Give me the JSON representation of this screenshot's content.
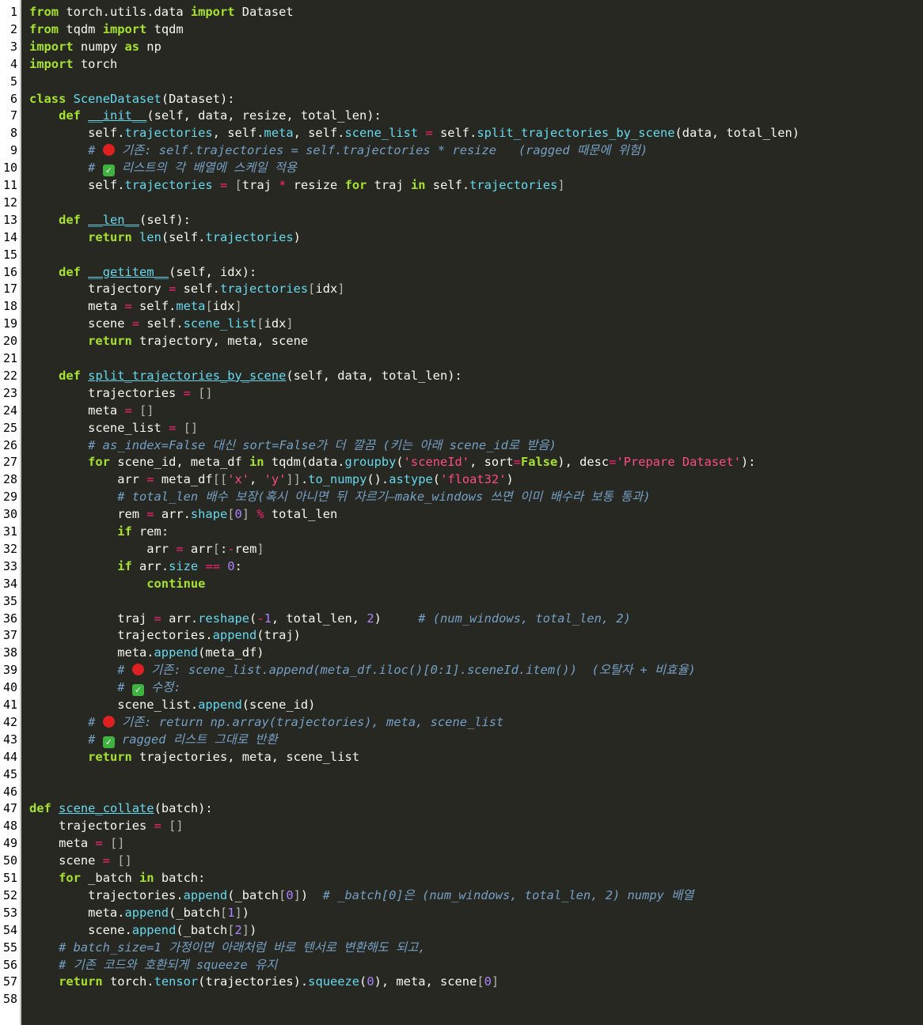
{
  "line_numbers": [
    "1",
    "2",
    "3",
    "4",
    "5",
    "6",
    "7",
    "8",
    "9",
    "10",
    "11",
    "12",
    "13",
    "14",
    "15",
    "16",
    "17",
    "18",
    "19",
    "20",
    "21",
    "22",
    "23",
    "24",
    "25",
    "26",
    "27",
    "28",
    "29",
    "30",
    "31",
    "32",
    "33",
    "34",
    "35",
    "36",
    "37",
    "38",
    "39",
    "40",
    "41",
    "42",
    "43",
    "44",
    "45",
    "46",
    "47",
    "48",
    "49",
    "50",
    "51",
    "52",
    "53",
    "54",
    "55",
    "56",
    "57",
    "58"
  ],
  "emoji": {
    "red_circle": "red-circle-icon",
    "check_mark": "check-mark-icon",
    "check_glyph": "✓"
  },
  "colors": {
    "background": "#272822",
    "gutter": "#ffffff",
    "keyword": "#a6e22e",
    "attribute": "#66d9ef",
    "string": "#fd4c86",
    "comment": "#75a0c5",
    "number": "#ae81ff",
    "operator": "#f92672",
    "text": "#f8f8f2"
  },
  "code_lines": [
    [
      [
        "k",
        "from"
      ],
      [
        "t",
        " torch.utils.data "
      ],
      [
        "k",
        "import"
      ],
      [
        "t",
        " Dataset"
      ]
    ],
    [
      [
        "k",
        "from"
      ],
      [
        "t",
        " tqdm "
      ],
      [
        "k",
        "import"
      ],
      [
        "t",
        " tqdm"
      ]
    ],
    [
      [
        "k",
        "import"
      ],
      [
        "t",
        " numpy "
      ],
      [
        "k",
        "as"
      ],
      [
        "t",
        " np"
      ]
    ],
    [
      [
        "k",
        "import"
      ],
      [
        "t",
        " torch"
      ]
    ],
    [],
    [
      [
        "k",
        "class"
      ],
      [
        "t",
        " "
      ],
      [
        "n",
        "SceneDataset"
      ],
      [
        "t",
        "(Dataset):"
      ]
    ],
    [
      [
        "t",
        "    "
      ],
      [
        "k",
        "def"
      ],
      [
        "t",
        " "
      ],
      [
        "f",
        "__init__"
      ],
      [
        "t",
        "(self, data, resize, total_len):"
      ]
    ],
    [
      [
        "t",
        "        self."
      ],
      [
        "n",
        "trajectories"
      ],
      [
        "t",
        ", self."
      ],
      [
        "n",
        "meta"
      ],
      [
        "t",
        ", self."
      ],
      [
        "n",
        "scene_list"
      ],
      [
        "t",
        " "
      ],
      [
        "o",
        "="
      ],
      [
        "t",
        " self."
      ],
      [
        "n",
        "split_trajectories_by_scene"
      ],
      [
        "t",
        "(data, total_len)"
      ]
    ],
    [
      [
        "t",
        "        "
      ],
      [
        "c",
        "# "
      ],
      [
        "r",
        ""
      ],
      [
        "c",
        " 기존: self.trajectories = self.trajectories * resize   (ragged 때문에 위험)"
      ]
    ],
    [
      [
        "t",
        "        "
      ],
      [
        "c",
        "# "
      ],
      [
        "g",
        ""
      ],
      [
        "c",
        " 리스트의 각 배열에 스케일 적용"
      ]
    ],
    [
      [
        "t",
        "        self."
      ],
      [
        "n",
        "trajectories"
      ],
      [
        "t",
        " "
      ],
      [
        "o",
        "="
      ],
      [
        "t",
        " "
      ],
      [
        "p",
        "["
      ],
      [
        "t",
        "traj "
      ],
      [
        "o",
        "*"
      ],
      [
        "t",
        " resize "
      ],
      [
        "k",
        "for"
      ],
      [
        "t",
        " traj "
      ],
      [
        "k",
        "in"
      ],
      [
        "t",
        " self."
      ],
      [
        "n",
        "trajectories"
      ],
      [
        "p",
        "]"
      ]
    ],
    [],
    [
      [
        "t",
        "    "
      ],
      [
        "k",
        "def"
      ],
      [
        "t",
        " "
      ],
      [
        "f",
        "__len__"
      ],
      [
        "t",
        "(self):"
      ]
    ],
    [
      [
        "t",
        "        "
      ],
      [
        "k",
        "return"
      ],
      [
        "t",
        " "
      ],
      [
        "n",
        "len"
      ],
      [
        "t",
        "(self."
      ],
      [
        "n",
        "trajectories"
      ],
      [
        "t",
        ")"
      ]
    ],
    [],
    [
      [
        "t",
        "    "
      ],
      [
        "k",
        "def"
      ],
      [
        "t",
        " "
      ],
      [
        "f",
        "__getitem__"
      ],
      [
        "t",
        "(self, idx):"
      ]
    ],
    [
      [
        "t",
        "        trajectory "
      ],
      [
        "o",
        "="
      ],
      [
        "t",
        " self."
      ],
      [
        "n",
        "trajectories"
      ],
      [
        "p",
        "["
      ],
      [
        "t",
        "idx"
      ],
      [
        "p",
        "]"
      ]
    ],
    [
      [
        "t",
        "        meta "
      ],
      [
        "o",
        "="
      ],
      [
        "t",
        " self."
      ],
      [
        "n",
        "meta"
      ],
      [
        "p",
        "["
      ],
      [
        "t",
        "idx"
      ],
      [
        "p",
        "]"
      ]
    ],
    [
      [
        "t",
        "        scene "
      ],
      [
        "o",
        "="
      ],
      [
        "t",
        " self."
      ],
      [
        "n",
        "scene_list"
      ],
      [
        "p",
        "["
      ],
      [
        "t",
        "idx"
      ],
      [
        "p",
        "]"
      ]
    ],
    [
      [
        "t",
        "        "
      ],
      [
        "k",
        "return"
      ],
      [
        "t",
        " trajectory, meta, scene"
      ]
    ],
    [],
    [
      [
        "t",
        "    "
      ],
      [
        "k",
        "def"
      ],
      [
        "t",
        " "
      ],
      [
        "f",
        "split_trajectories_by_scene"
      ],
      [
        "t",
        "(self, data, total_len):"
      ]
    ],
    [
      [
        "t",
        "        trajectories "
      ],
      [
        "o",
        "="
      ],
      [
        "t",
        " "
      ],
      [
        "p",
        "[]"
      ]
    ],
    [
      [
        "t",
        "        meta "
      ],
      [
        "o",
        "="
      ],
      [
        "t",
        " "
      ],
      [
        "p",
        "[]"
      ]
    ],
    [
      [
        "t",
        "        scene_list "
      ],
      [
        "o",
        "="
      ],
      [
        "t",
        " "
      ],
      [
        "p",
        "[]"
      ]
    ],
    [
      [
        "t",
        "        "
      ],
      [
        "c",
        "# as_index=False 대신 sort=False가 더 깔끔 (키는 아래 scene_id로 받음)"
      ]
    ],
    [
      [
        "t",
        "        "
      ],
      [
        "k",
        "for"
      ],
      [
        "t",
        " scene_id, meta_df "
      ],
      [
        "k",
        "in"
      ],
      [
        "t",
        " tqdm(data."
      ],
      [
        "n",
        "groupby"
      ],
      [
        "t",
        "("
      ],
      [
        "s",
        "'sceneId'"
      ],
      [
        "t",
        ", sort"
      ],
      [
        "o",
        "="
      ],
      [
        "k",
        "False"
      ],
      [
        "t",
        "), desc"
      ],
      [
        "o",
        "="
      ],
      [
        "s",
        "'Prepare Dataset'"
      ],
      [
        "t",
        "):"
      ]
    ],
    [
      [
        "t",
        "            arr "
      ],
      [
        "o",
        "="
      ],
      [
        "t",
        " meta_df"
      ],
      [
        "p",
        "[["
      ],
      [
        "s",
        "'x'"
      ],
      [
        "t",
        ", "
      ],
      [
        "s",
        "'y'"
      ],
      [
        "p",
        "]]"
      ],
      [
        "t",
        "."
      ],
      [
        "n",
        "to_numpy"
      ],
      [
        "t",
        "()."
      ],
      [
        "n",
        "astype"
      ],
      [
        "t",
        "("
      ],
      [
        "s",
        "'float32'"
      ],
      [
        "t",
        ")"
      ]
    ],
    [
      [
        "t",
        "            "
      ],
      [
        "c",
        "# total_len 배수 보장(혹시 아니면 뒤 자르기—make_windows 쓰면 이미 배수라 보통 통과)"
      ]
    ],
    [
      [
        "t",
        "            rem "
      ],
      [
        "o",
        "="
      ],
      [
        "t",
        " arr."
      ],
      [
        "n",
        "shape"
      ],
      [
        "p",
        "["
      ],
      [
        "num",
        "0"
      ],
      [
        "p",
        "]"
      ],
      [
        "t",
        " "
      ],
      [
        "o",
        "%"
      ],
      [
        "t",
        " total_len"
      ]
    ],
    [
      [
        "t",
        "            "
      ],
      [
        "k",
        "if"
      ],
      [
        "t",
        " rem:"
      ]
    ],
    [
      [
        "t",
        "                arr "
      ],
      [
        "o",
        "="
      ],
      [
        "t",
        " arr"
      ],
      [
        "p",
        "["
      ],
      [
        "t",
        ":"
      ],
      [
        "o",
        "-"
      ],
      [
        "t",
        "rem"
      ],
      [
        "p",
        "]"
      ]
    ],
    [
      [
        "t",
        "            "
      ],
      [
        "k",
        "if"
      ],
      [
        "t",
        " arr."
      ],
      [
        "n",
        "size"
      ],
      [
        "t",
        " "
      ],
      [
        "o",
        "=="
      ],
      [
        "t",
        " "
      ],
      [
        "num",
        "0"
      ],
      [
        "t",
        ":"
      ]
    ],
    [
      [
        "t",
        "                "
      ],
      [
        "k",
        "continue"
      ]
    ],
    [],
    [
      [
        "t",
        "            traj "
      ],
      [
        "o",
        "="
      ],
      [
        "t",
        " arr."
      ],
      [
        "n",
        "reshape"
      ],
      [
        "t",
        "("
      ],
      [
        "o",
        "-"
      ],
      [
        "num",
        "1"
      ],
      [
        "t",
        ", total_len, "
      ],
      [
        "num",
        "2"
      ],
      [
        "t",
        ")     "
      ],
      [
        "c",
        "# (num_windows, total_len, 2)"
      ]
    ],
    [
      [
        "t",
        "            trajectories."
      ],
      [
        "n",
        "append"
      ],
      [
        "t",
        "(traj)"
      ]
    ],
    [
      [
        "t",
        "            meta."
      ],
      [
        "n",
        "append"
      ],
      [
        "t",
        "(meta_df)"
      ]
    ],
    [
      [
        "t",
        "            "
      ],
      [
        "c",
        "# "
      ],
      [
        "r",
        ""
      ],
      [
        "c",
        " 기존: scene_list.append(meta_df.iloc()[0:1].sceneId.item())  (오탈자 + 비효율)"
      ]
    ],
    [
      [
        "t",
        "            "
      ],
      [
        "c",
        "# "
      ],
      [
        "g",
        ""
      ],
      [
        "c",
        " 수정:"
      ]
    ],
    [
      [
        "t",
        "            scene_list."
      ],
      [
        "n",
        "append"
      ],
      [
        "t",
        "(scene_id)"
      ]
    ],
    [
      [
        "t",
        "        "
      ],
      [
        "c",
        "# "
      ],
      [
        "r",
        ""
      ],
      [
        "c",
        " 기존: return np.array(trajectories), meta, scene_list"
      ]
    ],
    [
      [
        "t",
        "        "
      ],
      [
        "c",
        "# "
      ],
      [
        "g",
        ""
      ],
      [
        "c",
        " ragged 리스트 그대로 반환"
      ]
    ],
    [
      [
        "t",
        "        "
      ],
      [
        "k",
        "return"
      ],
      [
        "t",
        " trajectories, meta, scene_list"
      ]
    ],
    [],
    [],
    [
      [
        "k",
        "def"
      ],
      [
        "t",
        " "
      ],
      [
        "f",
        "scene_collate"
      ],
      [
        "t",
        "(batch):"
      ]
    ],
    [
      [
        "t",
        "    trajectories "
      ],
      [
        "o",
        "="
      ],
      [
        "t",
        " "
      ],
      [
        "p",
        "[]"
      ]
    ],
    [
      [
        "t",
        "    meta "
      ],
      [
        "o",
        "="
      ],
      [
        "t",
        " "
      ],
      [
        "p",
        "[]"
      ]
    ],
    [
      [
        "t",
        "    scene "
      ],
      [
        "o",
        "="
      ],
      [
        "t",
        " "
      ],
      [
        "p",
        "[]"
      ]
    ],
    [
      [
        "t",
        "    "
      ],
      [
        "k",
        "for"
      ],
      [
        "t",
        " _batch "
      ],
      [
        "k",
        "in"
      ],
      [
        "t",
        " batch:"
      ]
    ],
    [
      [
        "t",
        "        trajectories."
      ],
      [
        "n",
        "append"
      ],
      [
        "t",
        "(_batch"
      ],
      [
        "p",
        "["
      ],
      [
        "num",
        "0"
      ],
      [
        "p",
        "]"
      ],
      [
        "t",
        ")  "
      ],
      [
        "c",
        "# _batch[0]은 (num_windows, total_len, 2) numpy 배열"
      ]
    ],
    [
      [
        "t",
        "        meta."
      ],
      [
        "n",
        "append"
      ],
      [
        "t",
        "(_batch"
      ],
      [
        "p",
        "["
      ],
      [
        "num",
        "1"
      ],
      [
        "p",
        "]"
      ],
      [
        "t",
        ")"
      ]
    ],
    [
      [
        "t",
        "        scene."
      ],
      [
        "n",
        "append"
      ],
      [
        "t",
        "(_batch"
      ],
      [
        "p",
        "["
      ],
      [
        "num",
        "2"
      ],
      [
        "p",
        "]"
      ],
      [
        "t",
        ")"
      ]
    ],
    [
      [
        "t",
        "    "
      ],
      [
        "c",
        "# batch_size=1 가정이면 아래처럼 바로 텐서로 변환해도 되고,"
      ]
    ],
    [
      [
        "t",
        "    "
      ],
      [
        "c",
        "# 기존 코드와 호환되게 squeeze 유지"
      ]
    ],
    [
      [
        "t",
        "    "
      ],
      [
        "k",
        "return"
      ],
      [
        "t",
        " torch."
      ],
      [
        "n",
        "tensor"
      ],
      [
        "t",
        "(trajectories)."
      ],
      [
        "n",
        "squeeze"
      ],
      [
        "t",
        "("
      ],
      [
        "num",
        "0"
      ],
      [
        "t",
        "), meta, scene"
      ],
      [
        "p",
        "["
      ],
      [
        "num",
        "0"
      ],
      [
        "p",
        "]"
      ]
    ],
    []
  ]
}
